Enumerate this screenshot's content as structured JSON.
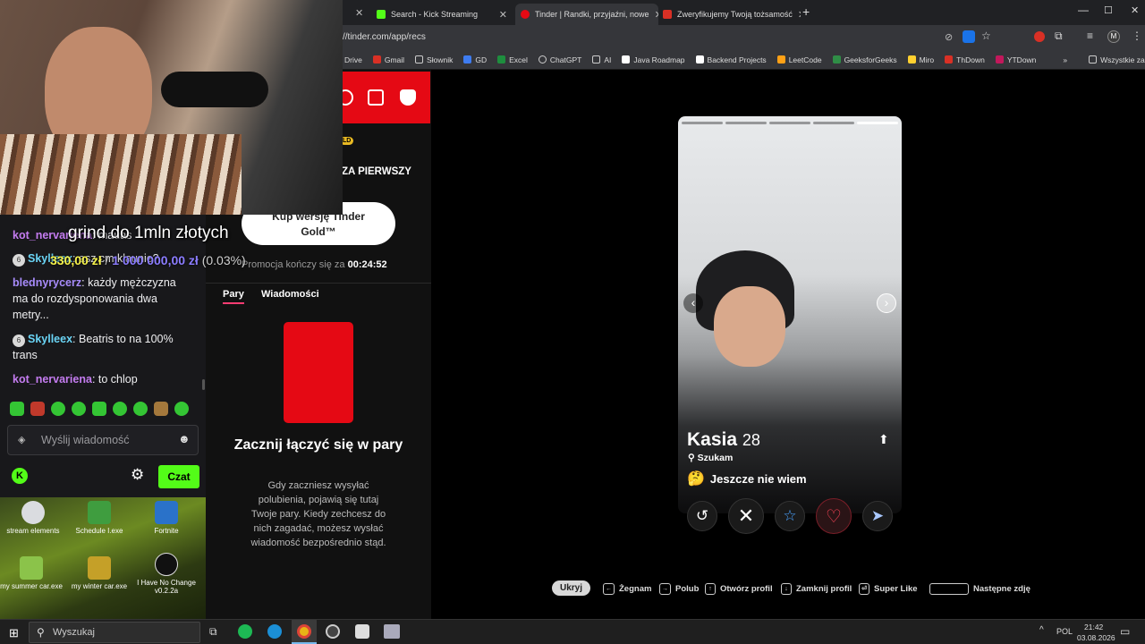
{
  "browser": {
    "tabs": [
      {
        "label": "Search - Kick Streaming",
        "color": "#53fc18"
      },
      {
        "label": "Tinder | Randki, przyjaźni, nowe",
        "color": "#e50914"
      },
      {
        "label": "Zweryfikujemy Twoją tożsamość",
        "color": "#d93025"
      }
    ],
    "address": "//tinder.com/app/recs",
    "bookmarks": [
      "Drive",
      "Gmail",
      "Słownik",
      "GD",
      "Excel",
      "ChatGPT",
      "AI",
      "Java Roadmap",
      "Backend Projects",
      "LeetCode",
      "GeeksforGeeks",
      "Miro",
      "ThDown",
      "YTDown"
    ],
    "all_bookmarks": "Wszystkie zakładki"
  },
  "tinder_left": {
    "gold_badge": "LD",
    "gold_headline": "ZA PIERWSZY",
    "buy_button": "Kup wersję Tinder Gold™",
    "promo_text": "Promocja kończy się za",
    "promo_timer": "00:24:52",
    "tabs": [
      "Pary",
      "Wiadomości"
    ],
    "empty_title": "Zacznij łączyć się w pary",
    "empty_body": "Gdy zaczniesz wysyłać polubienia, pojawią się tutaj Twoje pary. Kiedy zechcesz do nich zagadać, możesz wysłać wiadomość bezpośrednio stąd."
  },
  "profile": {
    "name": "Kasia",
    "age": "28",
    "looking_label": "Szukam",
    "looking_emoji": "🤔",
    "looking_value": "Jeszcze nie wiem"
  },
  "action_icons": [
    "undo-icon",
    "nope-icon",
    "super-like-icon",
    "like-icon",
    "boost-icon"
  ],
  "shortcuts": [
    {
      "key": "Ukryj",
      "label": ""
    },
    {
      "key": "←",
      "label": "Żegnam"
    },
    {
      "key": "→",
      "label": "Polub"
    },
    {
      "key": "↑",
      "label": "Otwórz profil"
    },
    {
      "key": "↓",
      "label": "Zamknij profil"
    },
    {
      "key": "⏎",
      "label": "Super Like"
    },
    {
      "key": "",
      "label": "Następne zdję"
    }
  ],
  "overlay": {
    "goal_title": "grind do 1mln złotych",
    "goal_current": "330,00 zł",
    "goal_target": "1 000 000,00 zł",
    "goal_percent": "(0.03%)"
  },
  "chat": {
    "messages": [
      {
        "user": "kot_nervariena",
        "color": "#c47cf0",
        "text": "mauas",
        "badge": ""
      },
      {
        "user": "Skylleex",
        "color": "#6ad4f5",
        "text": "asz cm klaunie?",
        "badge": "6"
      },
      {
        "user": "blednyrycerz",
        "color": "#a78bfa",
        "text": "każdy mężczyzna ma do rozdysponowania dwa metry...",
        "badge": ""
      },
      {
        "user": "Skylleex",
        "color": "#6ad4f5",
        "text": "Beatris to na 100% trans",
        "badge": "6"
      },
      {
        "user": "kot_nervariena",
        "color": "#c47cf0",
        "text": "to chlop",
        "badge": ""
      }
    ],
    "input_placeholder": "Wyślij wiadomość",
    "send_button": "Czat"
  },
  "desktop_icons": [
    "stream elements",
    "Schedule I.exe",
    "Fortnite",
    "my summer car.exe",
    "my winter car.exe",
    "I Have No Change v0.2.2a"
  ],
  "taskbar": {
    "search_placeholder": "Wyszukaj",
    "lang": "POL",
    "time": "21:42",
    "date": "03.08.2026"
  }
}
